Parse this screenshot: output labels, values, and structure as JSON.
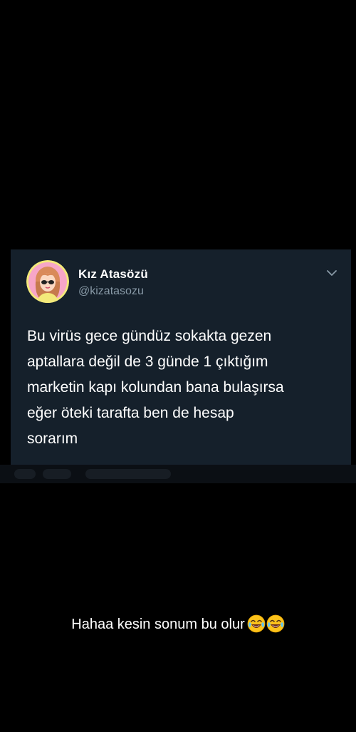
{
  "tweet": {
    "display_name": "Kız Atasözü",
    "handle": "@kizatasozu",
    "text": "Bu virüs gece gündüz sokakta gezen\naptallara değil de 3 günde 1 çıktığım\nmarketin kapı kolundan bana bulaşırsa\neğer öteki tarafta ben de hesap\nsorarım",
    "avatar_icon": "cartoon-girl-avatar-icon",
    "menu_icon": "chevron-down-icon"
  },
  "caption": {
    "text": "Hahaa kesin sonum bu olur",
    "emojis": [
      "face-with-tears-of-joy-icon",
      "face-with-tears-of-joy-icon"
    ]
  },
  "colors": {
    "background": "#000000",
    "card": "#15202b",
    "text": "#ffffff",
    "secondary_text": "#8899a6"
  }
}
